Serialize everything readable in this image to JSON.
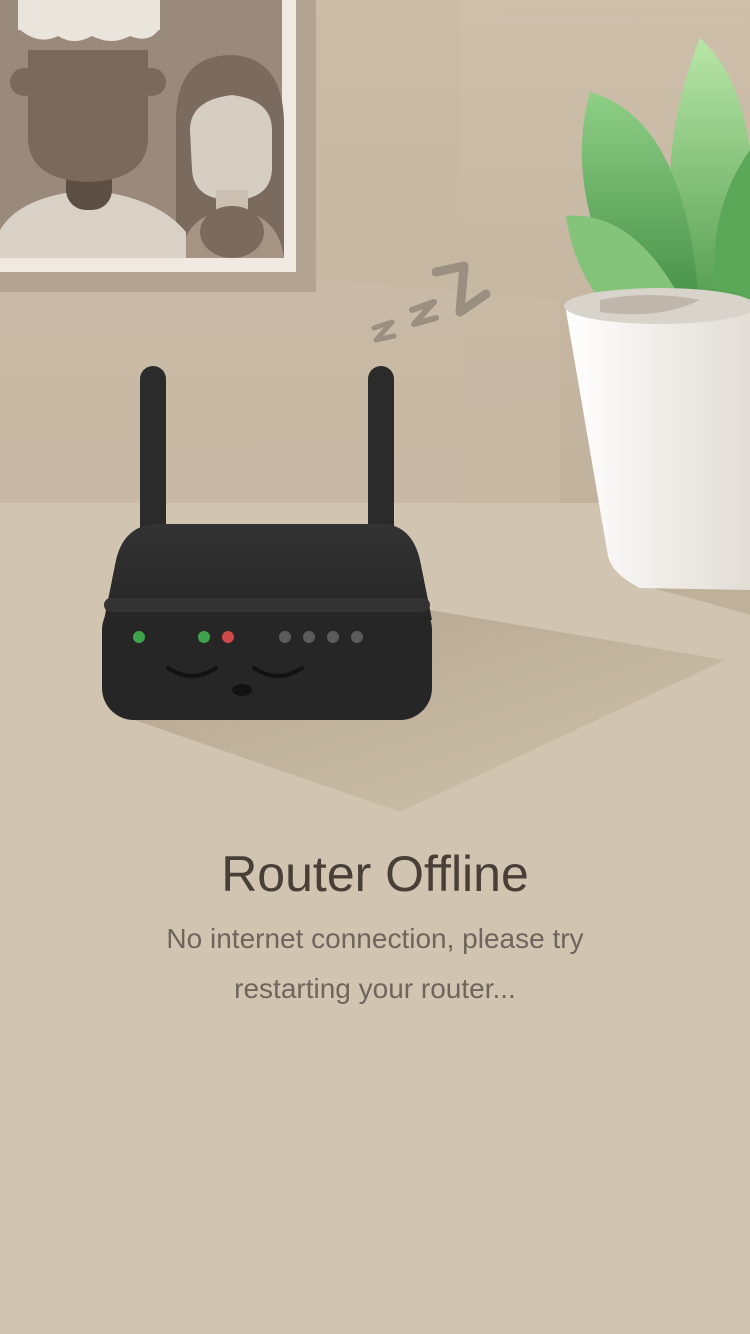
{
  "colors": {
    "background": "#d1c5b1",
    "wall": "#c4b5a0",
    "title": "#4a3f37",
    "message": "#6f655c",
    "router_body": "#2a2a2a",
    "led_green": "#3fa34d",
    "led_red": "#d04a4a",
    "led_off": "#5c5c5c",
    "plant": "#6fbf6a",
    "pot": "#f2f0ec"
  },
  "illustration": {
    "sleeping_router_icon": "sleeping-router",
    "sleep_symbol": "zzz",
    "picture_frame_icon": "family-photo",
    "plant_icon": "potted-plant",
    "leds": [
      {
        "state": "on",
        "color": "green"
      },
      {
        "state": "on",
        "color": "green"
      },
      {
        "state": "on",
        "color": "red"
      },
      {
        "state": "off",
        "color": "gray"
      },
      {
        "state": "off",
        "color": "gray"
      },
      {
        "state": "off",
        "color": "gray"
      },
      {
        "state": "off",
        "color": "gray"
      }
    ]
  },
  "status": {
    "title": "Router Offline",
    "message_line1": "No internet connection, please try",
    "message_line2": "restarting your router..."
  }
}
